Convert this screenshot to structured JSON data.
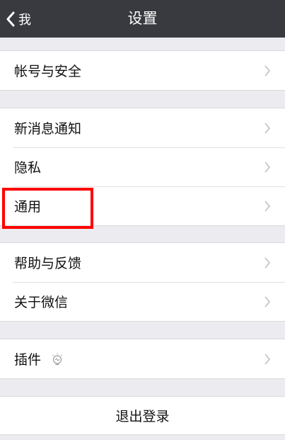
{
  "navbar": {
    "back_label": "我",
    "title": "设置"
  },
  "groups": [
    {
      "items": [
        {
          "label": "帐号与安全"
        }
      ]
    },
    {
      "items": [
        {
          "label": "新消息通知"
        },
        {
          "label": "隐私"
        },
        {
          "label": "通用"
        }
      ]
    },
    {
      "items": [
        {
          "label": "帮助与反馈"
        },
        {
          "label": "关于微信"
        }
      ]
    },
    {
      "items": [
        {
          "label": "插件"
        }
      ]
    }
  ],
  "logout": {
    "label": "退出登录"
  },
  "colors": {
    "navbar_bg": "#393a3f",
    "page_bg": "#ebebf0",
    "highlight": "#ff0000"
  },
  "icons": {
    "back": "chevron-left-icon",
    "row_arrow": "chevron-right-icon",
    "plugin": "lightbulb-icon"
  }
}
